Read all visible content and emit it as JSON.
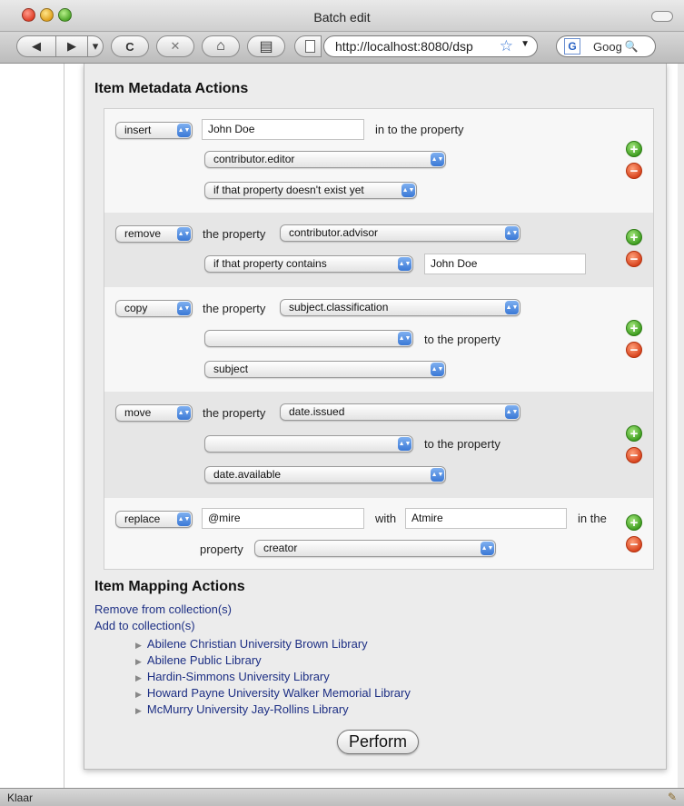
{
  "window": {
    "title": "Batch edit",
    "url": "http://localhost:8080/dsp",
    "search_text": "Goog",
    "status": "Klaar"
  },
  "toolbar": {
    "back_icon": "◀",
    "forward_icon": "▶",
    "dropdown_icon": "▾",
    "reload_icon": "C",
    "stop_icon": "✕",
    "home_icon": "⌂",
    "bookmarks_icon": "▤"
  },
  "metadata": {
    "heading": "Item Metadata Actions",
    "rows": [
      {
        "action": "insert",
        "value": "John Doe",
        "text_after": "in to the property",
        "property": "contributor.editor",
        "condition": "if that property doesn't exist yet"
      },
      {
        "action": "remove",
        "text_property": "the property",
        "property": "contributor.advisor",
        "condition": "if that property contains",
        "value": "John Doe"
      },
      {
        "action": "copy",
        "text_property": "the property",
        "property": "subject.classification",
        "middle_select": "",
        "text_to": "to the property",
        "target": "subject"
      },
      {
        "action": "move",
        "text_property": "the property",
        "property": "date.issued",
        "middle_select": "",
        "text_to": "to the property",
        "target": "date.available"
      },
      {
        "action": "replace",
        "find": "@mire",
        "text_with": "with",
        "replace_with": "Atmire",
        "text_in": "in the",
        "text_property": "property",
        "property": "creator"
      }
    ]
  },
  "mapping": {
    "heading": "Item Mapping Actions",
    "remove_link": "Remove from collection(s)",
    "add_link": "Add to collection(s)",
    "collections": [
      "Abilene Christian University Brown Library",
      "Abilene Public Library",
      "Hardin-Simmons University Library",
      "Howard Payne University Walker Memorial Library",
      "McMurry University Jay-Rollins Library"
    ]
  },
  "perform_label": "Perform",
  "colors": {
    "link": "#1d2f84",
    "add": "#3a9a1c",
    "remove": "#d6401a",
    "select_arrow": "#3a78d6"
  }
}
